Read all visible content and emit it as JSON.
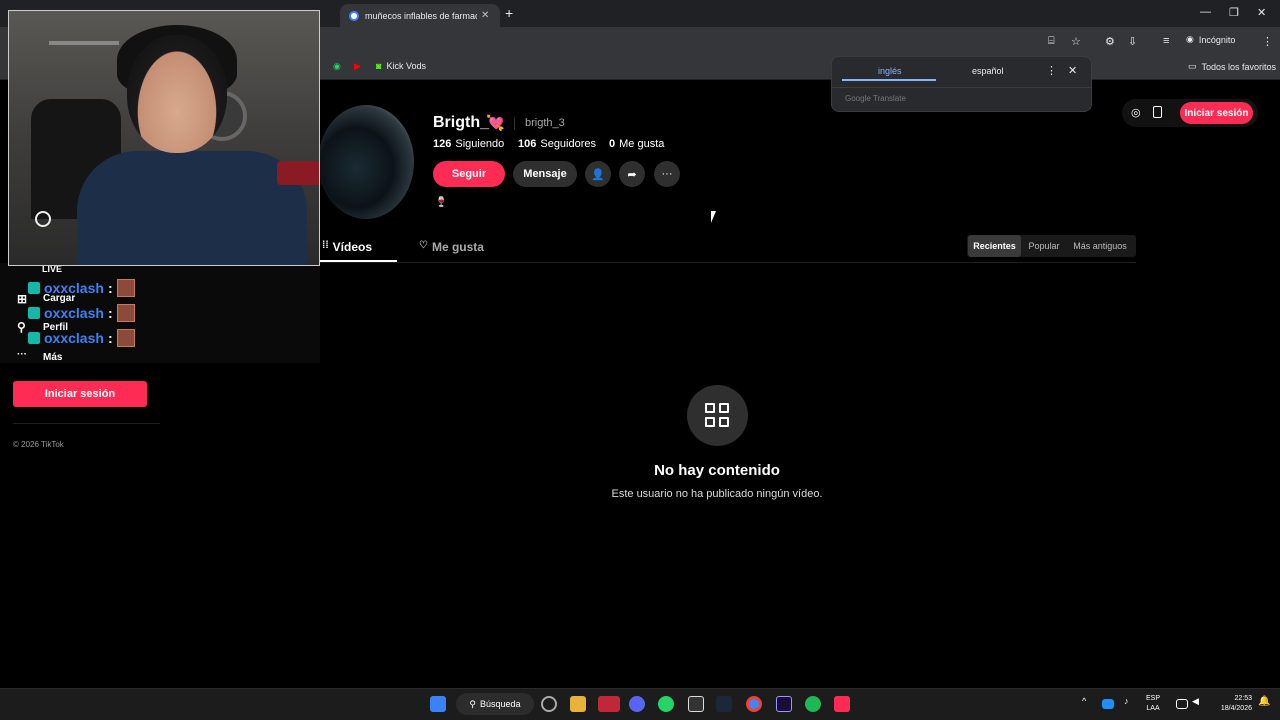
{
  "browser": {
    "active_tab_title": "muñecos inflables de farmacias",
    "incognito_label": "Incógnito",
    "bookmarks": [
      {
        "label": "Kick Vods"
      }
    ],
    "all_bookmarks_label": "Todos los favoritos"
  },
  "translate_popup": {
    "source_lang": "inglés",
    "target_lang": "español",
    "brand": "Google Translate"
  },
  "header": {
    "login_label": "Iniciar sesión"
  },
  "profile": {
    "username": "Brigth_",
    "handle": "brigth_3",
    "following_count": "126",
    "following_label": "Siguiendo",
    "followers_count": "106",
    "followers_label": "Seguidores",
    "likes_count": "0",
    "likes_label": "Me gusta",
    "follow_label": "Seguir",
    "message_label": "Mensaje"
  },
  "tabs": {
    "videos_label": "Vídeos",
    "liked_label": "Me gusta"
  },
  "sort": {
    "recent": "Recientes",
    "popular": "Popular",
    "oldest": "Más antiguos"
  },
  "empty_state": {
    "title": "No hay contenido",
    "subtitle": "Este usuario no ha publicado ningún vídeo."
  },
  "sidebar": {
    "items": [
      {
        "label": "LIVE"
      },
      {
        "label": "Cargar"
      },
      {
        "label": "Perfil"
      },
      {
        "label": "Más"
      }
    ],
    "login_label": "Iniciar sesión",
    "copyright": "© 2026 TikTok"
  },
  "chat_overlay": {
    "lines": [
      {
        "user": "oxxclash",
        "sep": ":"
      },
      {
        "user": "oxxclash",
        "sep": ":"
      },
      {
        "user": "oxxclash",
        "sep": ":"
      }
    ]
  },
  "taskbar": {
    "search_label": "Búsqueda",
    "lang_top": "ESP",
    "lang_bottom": "LAA",
    "time": "22:53",
    "date": "18/4/2026"
  },
  "colors": {
    "accent": "#fe2c55",
    "chat_user": "#3b82f6"
  }
}
